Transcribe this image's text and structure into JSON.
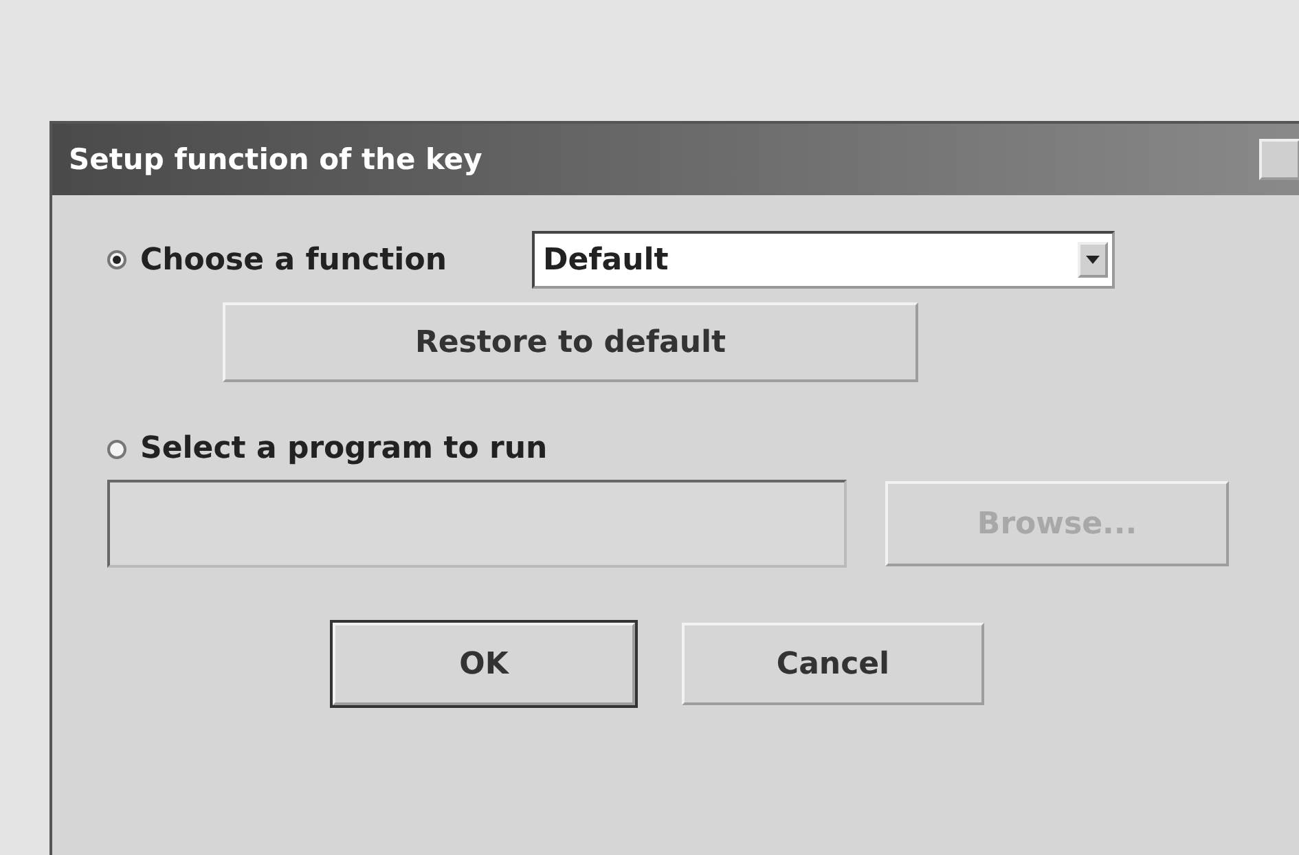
{
  "window": {
    "title": "Setup function of the key"
  },
  "options": [
    {
      "label": "Choose a function",
      "selected": true
    },
    {
      "label": "Select a program to run",
      "selected": false
    }
  ],
  "function_select": {
    "value": "Default"
  },
  "restore_button": {
    "label": "Restore to default"
  },
  "program_field": {
    "disabled": true
  },
  "browse_button": {
    "label": "Browse...",
    "disabled": true
  },
  "buttons": [
    {
      "label": "OK",
      "default": true
    },
    {
      "label": "Cancel",
      "default": false
    }
  ]
}
